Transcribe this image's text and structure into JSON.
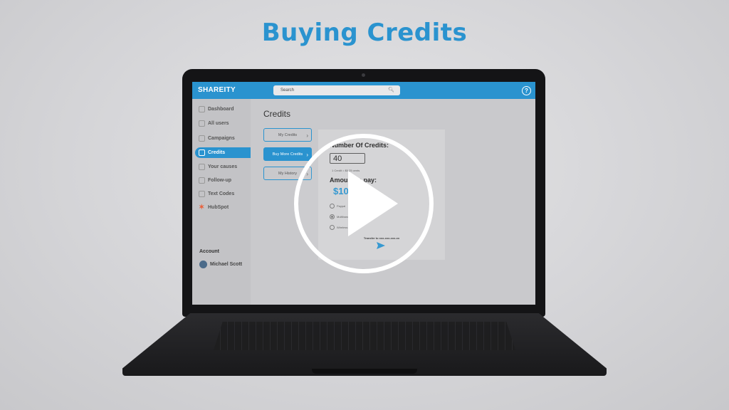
{
  "headline": "Buying Credits",
  "app": {
    "brand": "SHAREITY",
    "search_placeholder": "Search",
    "help": "?"
  },
  "sidebar": {
    "items": [
      {
        "label": "Dashboard",
        "icon": "home-icon"
      },
      {
        "label": "All users",
        "icon": "users-icon"
      },
      {
        "label": "Campaigns",
        "icon": "grid-icon"
      },
      {
        "label": "Credits",
        "icon": "credits-icon",
        "active": true
      },
      {
        "label": "Your causes",
        "icon": "heart-hand-icon"
      },
      {
        "label": "Follow-up",
        "icon": "megaphone-icon"
      },
      {
        "label": "Text Codes",
        "icon": "code-icon"
      },
      {
        "label": "HubSpot",
        "icon": "hubspot-icon"
      }
    ],
    "account_title": "Account",
    "account_name": "Michael Scott"
  },
  "main": {
    "title": "Credits",
    "subnav": [
      {
        "label": "My Credits"
      },
      {
        "label": "Buy More Credits",
        "active": true
      },
      {
        "label": "My History"
      }
    ],
    "card": {
      "number_label": "Number Of Credits:",
      "number_value": "40",
      "rate": "1 Credit = $0.25 cents",
      "amount_label": "Amount to pay:",
      "amount_value": "$10",
      "payment_options": [
        {
          "label": "Paypal",
          "selected": false
        },
        {
          "label": "Multibanco",
          "selected": true
        },
        {
          "label": "Wireless",
          "selected": false
        }
      ],
      "transfer_text": "Transfer to xxx-xxx-xxx-xx"
    }
  },
  "colors": {
    "accent": "#2a93cf",
    "hubspot": "#e8613c"
  },
  "overlay": {
    "icon": "play-icon"
  }
}
